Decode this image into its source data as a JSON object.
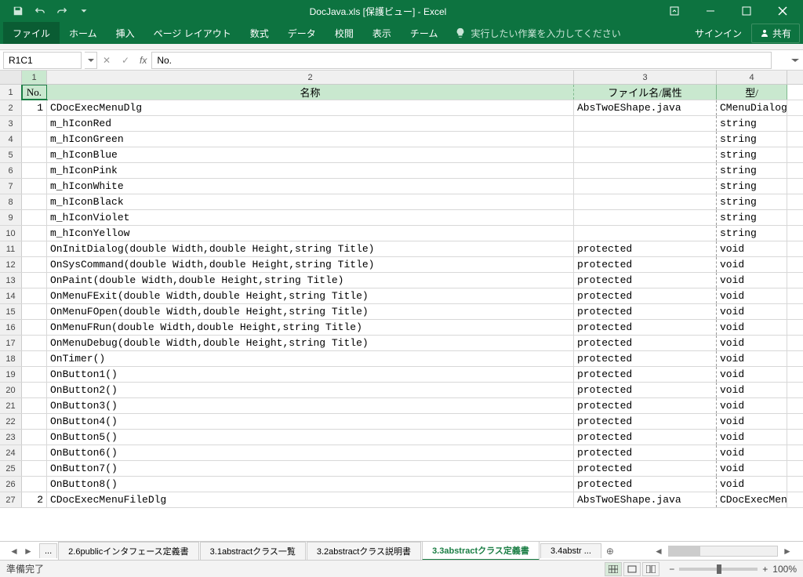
{
  "title": "DocJava.xls  [保護ビュー] - Excel",
  "ribbon": {
    "file": "ファイル",
    "home": "ホーム",
    "insert": "挿入",
    "layout": "ページ レイアウト",
    "formulas": "数式",
    "data": "データ",
    "review": "校閲",
    "view": "表示",
    "team": "チーム",
    "tell": "実行したい作業を入力してください",
    "signin": "サインイン",
    "share": "共有"
  },
  "namebox": "R1C1",
  "formula": "No.",
  "colHeaders": [
    "1",
    "2",
    "3",
    "4"
  ],
  "headerRow": {
    "no": "No.",
    "name": "名称",
    "file": "ファイル名/属性",
    "type": "型/"
  },
  "rows": [
    {
      "no": "1",
      "name": "CDocExecMenuDlg",
      "file": "AbsTwoEShape.java",
      "type": "CMenuDialog"
    },
    {
      "no": "",
      "name": "m_hIconRed",
      "file": "",
      "type": "string"
    },
    {
      "no": "",
      "name": "m_hIconGreen",
      "file": "",
      "type": "string"
    },
    {
      "no": "",
      "name": "m_hIconBlue",
      "file": "",
      "type": "string"
    },
    {
      "no": "",
      "name": "m_hIconPink",
      "file": "",
      "type": "string"
    },
    {
      "no": "",
      "name": "m_hIconWhite",
      "file": "",
      "type": "string"
    },
    {
      "no": "",
      "name": "m_hIconBlack",
      "file": "",
      "type": "string"
    },
    {
      "no": "",
      "name": "m_hIconViolet",
      "file": "",
      "type": "string"
    },
    {
      "no": "",
      "name": "m_hIconYellow",
      "file": "",
      "type": "string"
    },
    {
      "no": "",
      "name": "OnInitDialog(double Width,double Height,string Title)",
      "file": "protected",
      "type": "void"
    },
    {
      "no": "",
      "name": "OnSysCommand(double Width,double Height,string Title)",
      "file": "protected",
      "type": "void"
    },
    {
      "no": "",
      "name": "OnPaint(double Width,double Height,string Title)",
      "file": "protected",
      "type": "void"
    },
    {
      "no": "",
      "name": "OnMenuFExit(double Width,double Height,string Title)",
      "file": "protected",
      "type": "void"
    },
    {
      "no": "",
      "name": "OnMenuFOpen(double Width,double Height,string Title)",
      "file": "protected",
      "type": "void"
    },
    {
      "no": "",
      "name": "OnMenuFRun(double Width,double Height,string Title)",
      "file": "protected",
      "type": "void"
    },
    {
      "no": "",
      "name": "OnMenuDebug(double Width,double Height,string Title)",
      "file": "protected",
      "type": "void"
    },
    {
      "no": "",
      "name": "OnTimer()",
      "file": "protected",
      "type": "void"
    },
    {
      "no": "",
      "name": "OnButton1()",
      "file": "protected",
      "type": "void"
    },
    {
      "no": "",
      "name": "OnButton2()",
      "file": "protected",
      "type": "void"
    },
    {
      "no": "",
      "name": "OnButton3()",
      "file": "protected",
      "type": "void"
    },
    {
      "no": "",
      "name": "OnButton4()",
      "file": "protected",
      "type": "void"
    },
    {
      "no": "",
      "name": "OnButton5()",
      "file": "protected",
      "type": "void"
    },
    {
      "no": "",
      "name": "OnButton6()",
      "file": "protected",
      "type": "void"
    },
    {
      "no": "",
      "name": "OnButton7()",
      "file": "protected",
      "type": "void"
    },
    {
      "no": "",
      "name": "OnButton8()",
      "file": "protected",
      "type": "void"
    },
    {
      "no": "2",
      "name": "CDocExecMenuFileDlg",
      "file": "AbsTwoEShape.java",
      "type": "CDocExecMen"
    }
  ],
  "sheets": {
    "ell1": "...",
    "t1": "2.6publicインタフェース定義書",
    "t2": "3.1abstractクラス一覧",
    "t3": "3.2abstractクラス説明書",
    "active": "3.3abstractクラス定義書",
    "t5": "3.4abstr ...",
    "ell2": "..."
  },
  "status": {
    "ready": "準備完了",
    "zoom": "100%"
  }
}
